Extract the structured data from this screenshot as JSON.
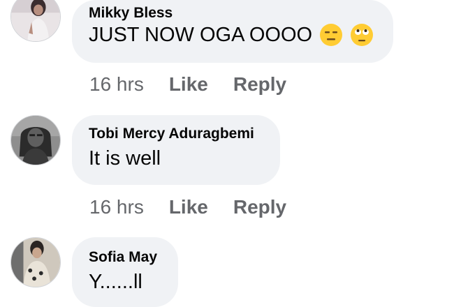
{
  "comments": [
    {
      "author": "Mikky Bless",
      "text": "JUST NOW OGA OOOO",
      "emojis": [
        "expressionless-face-emoji",
        "face-with-rolling-eyes-emoji"
      ],
      "time": "16 hrs",
      "like_label": "Like",
      "reply_label": "Reply"
    },
    {
      "author": "Tobi Mercy Aduragbemi",
      "text": "It is well",
      "time": "16 hrs",
      "like_label": "Like",
      "reply_label": "Reply"
    },
    {
      "author": "Sofia May",
      "text": "Y......ll"
    }
  ],
  "colors": {
    "bubble": "#f0f2f5",
    "meta_text": "#65676b",
    "name_text": "#050505",
    "emoji_face": "#ffcc33"
  }
}
